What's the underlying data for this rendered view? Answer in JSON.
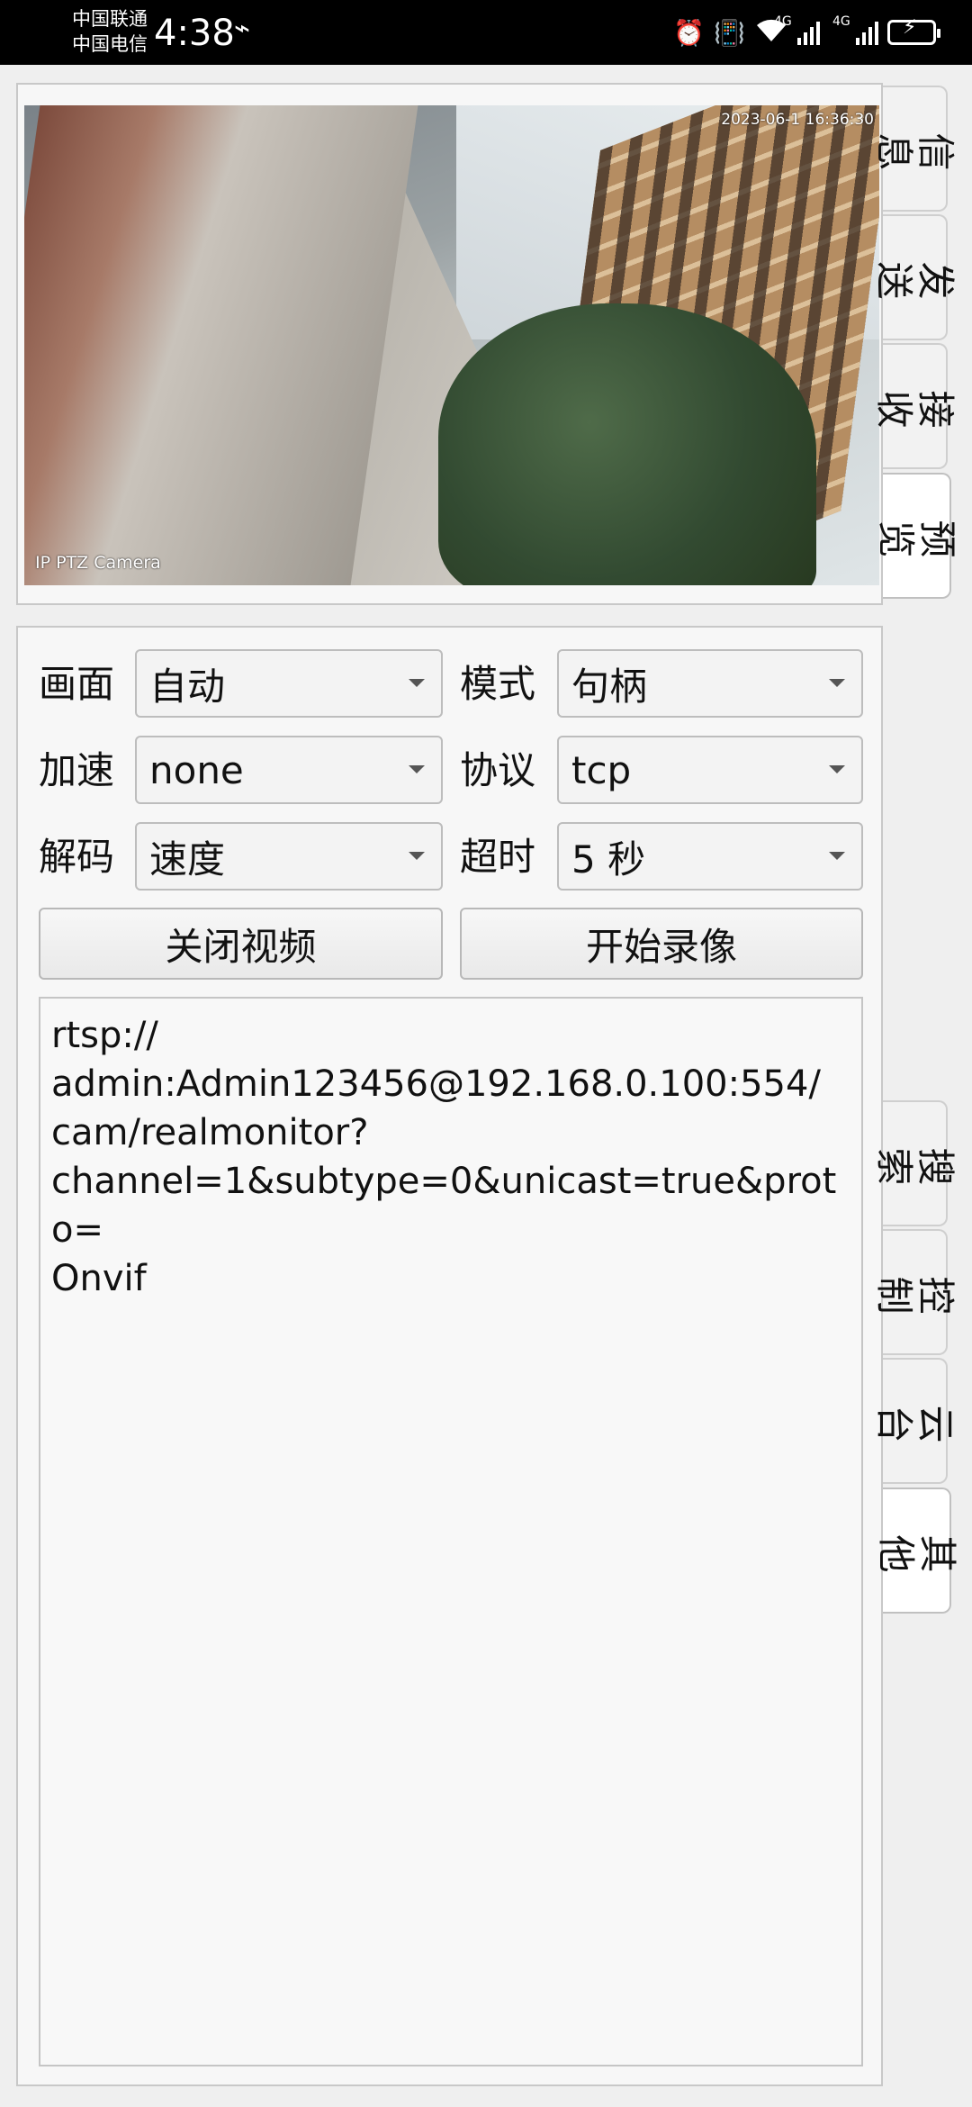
{
  "status_bar": {
    "carrier_1": "中国联通",
    "carrier_2": "中国电信",
    "time": "4:38",
    "network_tag_1": "4G",
    "network_tag_2": "4G"
  },
  "video": {
    "timestamp": "2023-06-1 16:36:30",
    "osd_label": "IP PTZ Camera"
  },
  "top_tabs": [
    {
      "label": "信息"
    },
    {
      "label": "发送"
    },
    {
      "label": "接收"
    },
    {
      "label": "预览",
      "active": true
    }
  ],
  "bottom_tabs": [
    {
      "label": "搜索"
    },
    {
      "label": "控制"
    },
    {
      "label": "云台"
    },
    {
      "label": "其他",
      "active": true
    }
  ],
  "settings": {
    "picture": {
      "label": "画面",
      "value": "自动"
    },
    "mode": {
      "label": "模式",
      "value": "句柄"
    },
    "accel": {
      "label": "加速",
      "value": "none"
    },
    "protocol": {
      "label": "协议",
      "value": "tcp"
    },
    "decode": {
      "label": "解码",
      "value": "速度"
    },
    "timeout": {
      "label": "超时",
      "value": "5 秒"
    }
  },
  "buttons": {
    "close_video": "关闭视频",
    "start_record": "开始录像"
  },
  "url_lines": [
    "rtsp://",
    "admin:Admin123456@192.168.0.100:554/",
    "cam/realmonitor?",
    "channel=1&subtype=0&unicast=true&proto=",
    "Onvif"
  ],
  "colors": {
    "status_bar_bg": "#000000",
    "page_bg": "#efefef",
    "panel_bg": "#f7f7f7"
  }
}
